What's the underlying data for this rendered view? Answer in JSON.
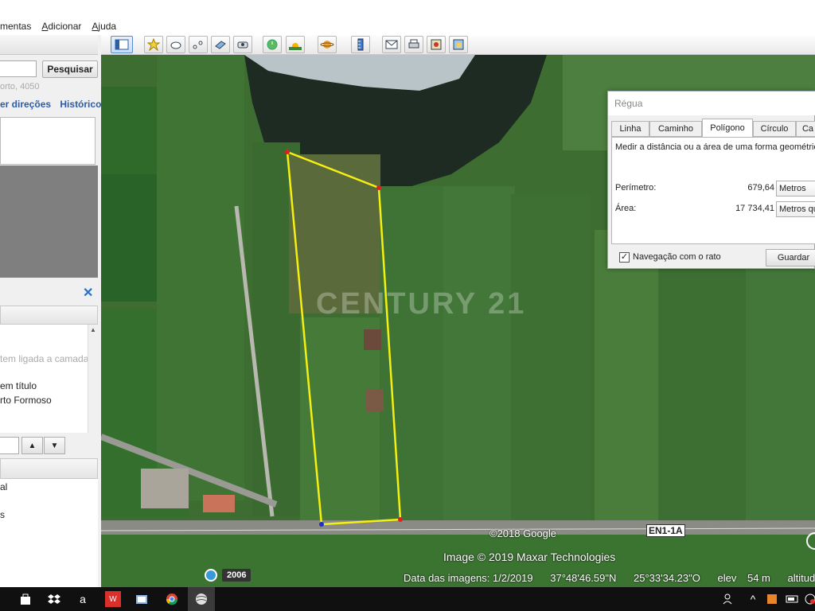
{
  "menubar": {
    "items": [
      "mentas",
      "Adicionar",
      "Ajuda"
    ]
  },
  "search": {
    "button_label": "Pesquisar",
    "placeholder": "orto, 4050",
    "link_directions": "er direções",
    "link_history": "Histórico"
  },
  "places": {
    "hint": "tem ligada a camada",
    "items": [
      "em título",
      "rto Formoso"
    ]
  },
  "layers": {
    "items": [
      "al",
      "s"
    ]
  },
  "toolbar": {
    "icons": [
      "sidebar-toggle-icon",
      "placemark-icon",
      "polygon-icon",
      "path-icon",
      "overlay-icon",
      "tour-icon",
      "history-clock-icon",
      "sunlight-icon",
      "planets-icon",
      "ruler-icon",
      "email-icon",
      "print-icon",
      "save-image-icon",
      "maps-view-icon"
    ]
  },
  "map": {
    "watermark": "CENTURY 21",
    "copyright": "©2018 Google",
    "road_sign": "EN1-1A",
    "image_credit": "Image © 2019 Maxar Technologies",
    "history_year": "2006",
    "status": {
      "imagery_date": "Data das imagens: 1/2/2019",
      "latitude": "37°48'46.59\"N",
      "longitude": "25°33'34.23\"O",
      "elev": "elev",
      "elev_value": "54 m",
      "altitude": "altitude d"
    }
  },
  "ruler": {
    "title": "Régua",
    "tabs": [
      "Linha",
      "Caminho",
      "Polígono",
      "Círculo",
      "Ca"
    ],
    "active_tab": "Polígono",
    "description": "Medir a distância ou a área de uma forma geométrica",
    "perimeter_label": "Perímetro:",
    "perimeter_value": "679,64",
    "perimeter_unit": "Metros",
    "area_label": "Área:",
    "area_value": "17 734,41",
    "area_unit": "Metros qu",
    "mouse_nav_label": "Navegação com o rato",
    "mouse_nav_checked": true,
    "save_label": "Guardar"
  },
  "colors": {
    "polygon_stroke": "#f5f010",
    "vertex": "#e02020",
    "link": "#2a5caa"
  }
}
